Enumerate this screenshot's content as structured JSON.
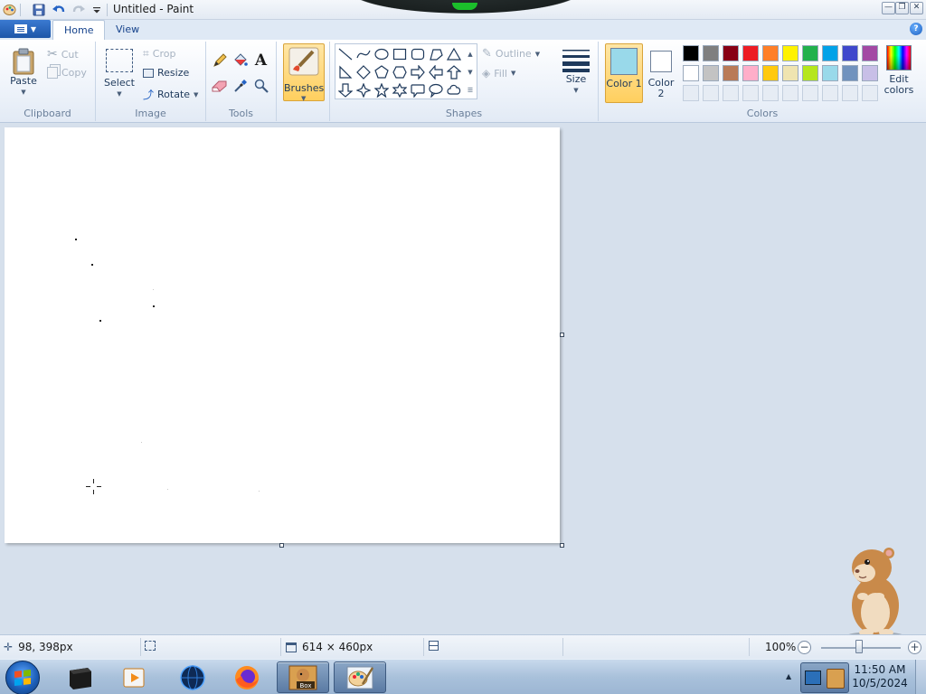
{
  "window": {
    "title": "Untitled - Paint"
  },
  "quick_access": {
    "icons": [
      "paint-app-icon",
      "save-icon",
      "undo-icon",
      "redo-icon",
      "customize-dropdown-icon"
    ]
  },
  "ribbon": {
    "tabs": [
      {
        "label": "Home",
        "active": true
      },
      {
        "label": "View",
        "active": false
      }
    ],
    "clipboard": {
      "group_label": "Clipboard",
      "paste": "Paste",
      "cut": "Cut",
      "copy": "Copy"
    },
    "image": {
      "group_label": "Image",
      "select": "Select",
      "crop": "Crop",
      "resize": "Resize",
      "rotate": "Rotate"
    },
    "tools": {
      "group_label": "Tools",
      "items": [
        "pencil-icon",
        "fill-bucket-icon",
        "text-icon",
        "eraser-icon",
        "color-picker-icon",
        "magnifier-icon"
      ]
    },
    "brushes": {
      "label": "Brushes"
    },
    "shapes": {
      "group_label": "Shapes",
      "outline": "Outline",
      "fill": "Fill"
    },
    "size": {
      "label": "Size"
    },
    "colors": {
      "group_label": "Colors",
      "color1_label": "Color 1",
      "color2_label": "Color 2",
      "color1_value": "#99d9ea",
      "color2_value": "#ffffff",
      "edit_label": "Edit colors",
      "palette_row1": [
        "#000000",
        "#7f7f7f",
        "#880015",
        "#ed1c24",
        "#ff7f27",
        "#fff200",
        "#22b14c",
        "#00a2e8",
        "#3f48cc",
        "#a349a4"
      ],
      "palette_row2": [
        "#ffffff",
        "#c3c3c3",
        "#b97a57",
        "#ffaec9",
        "#ffc90e",
        "#efe4b0",
        "#b5e61d",
        "#99d9ea",
        "#7092be",
        "#c8bfe7"
      ]
    }
  },
  "statusbar": {
    "cursor_position": "98, 398px",
    "canvas_size": "614 × 460px",
    "zoom": "100%",
    "zoom_level": 1.0
  },
  "taskbar": {
    "clock_time": "11:50 AM",
    "clock_date": "10/5/2024",
    "box_label": "Box"
  }
}
